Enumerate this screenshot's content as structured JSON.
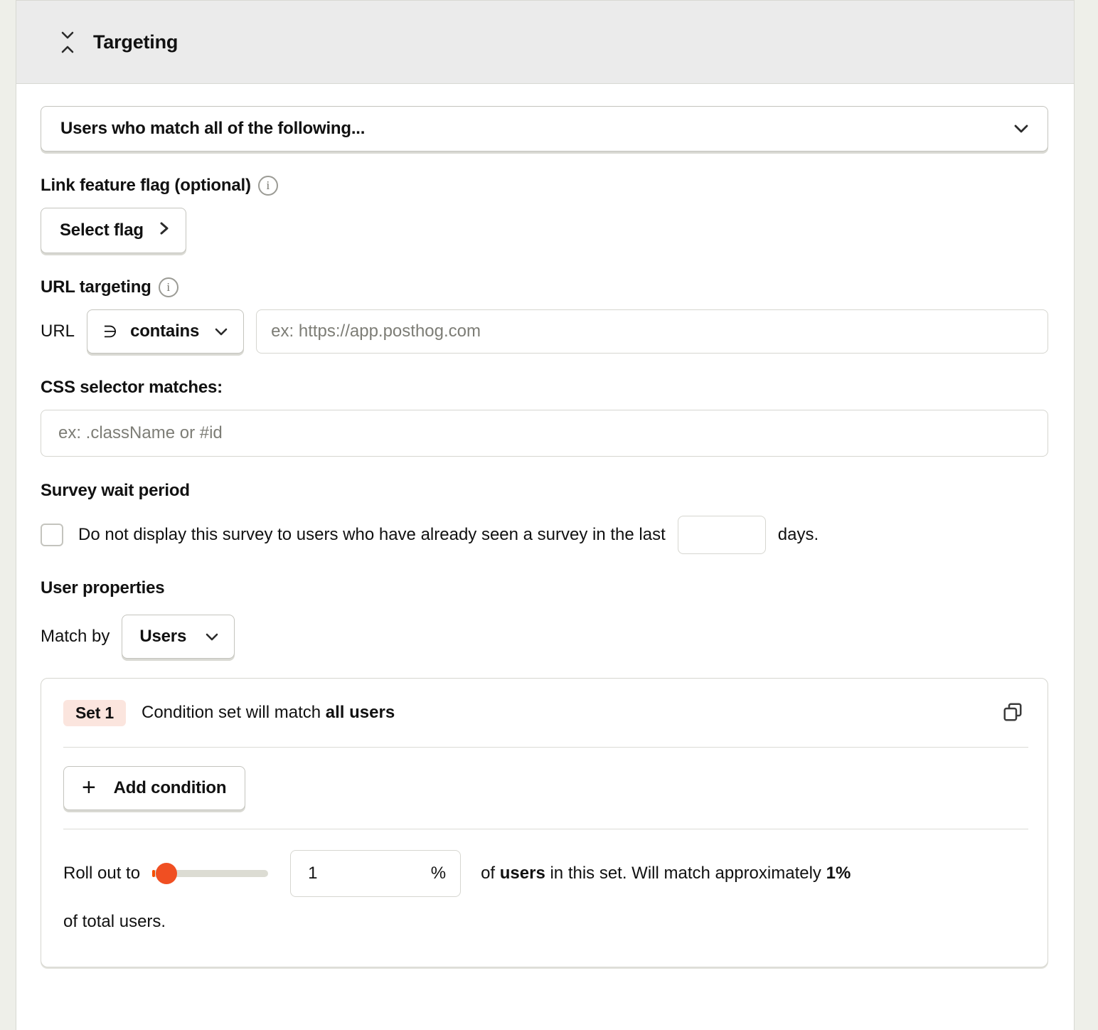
{
  "header": {
    "title": "Targeting",
    "collapse_icon": "collapse-chevrons-icon"
  },
  "targeting": {
    "match_select": {
      "value": "Users who match all of the following...",
      "chevron_icon": "chevron-down-icon"
    },
    "feature_flag": {
      "label": "Link feature flag (optional)",
      "info_icon": "info-icon",
      "button_label": "Select flag",
      "button_icon": "chevron-right-icon"
    },
    "url_targeting": {
      "label": "URL targeting",
      "info_icon": "info-icon",
      "url_prefix": "URL",
      "operator_symbol": "∋",
      "operator_label": "contains",
      "operator_chevron": "chevron-down-icon",
      "url_placeholder": "ex: https://app.posthog.com",
      "url_value": ""
    },
    "css_selector": {
      "label": "CSS selector matches:",
      "placeholder": "ex: .className or #id",
      "value": ""
    },
    "wait_period": {
      "label": "Survey wait period",
      "checkbox_checked": "false",
      "text_before": "Do not display this survey to users who have already seen a survey in the last",
      "days_value": "",
      "text_after": "days."
    },
    "user_properties": {
      "label": "User properties",
      "match_by_label": "Match by",
      "match_by_value": "Users",
      "match_by_chevron": "chevron-down-icon"
    },
    "condition_set": {
      "badge": "Set 1",
      "description_prefix": "Condition set will match ",
      "description_bold": "all users",
      "duplicate_icon": "duplicate-icon",
      "add_condition_label": "Add condition",
      "add_condition_icon": "plus-icon",
      "rollout": {
        "label": "Roll out to",
        "slider_value": "1",
        "percent_value": "1",
        "percent_sign": "%",
        "tail_prefix": "of ",
        "tail_bold_1": "users",
        "tail_middle": " in this set. Will match approximately ",
        "tail_bold_2": "1%",
        "second_line": "of total users."
      }
    }
  },
  "colors": {
    "brand_orange": "#F54E00",
    "badge_bg": "#FBE5DE",
    "page_bg": "#EEEFE9",
    "header_bg": "#EBEBEB"
  }
}
